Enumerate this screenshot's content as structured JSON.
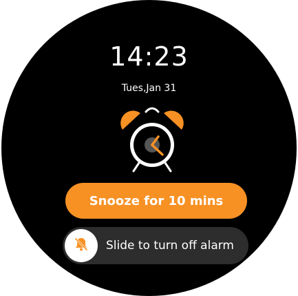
{
  "alarm": {
    "time": "14:23",
    "date": "Tues,Jan 31"
  },
  "actions": {
    "snooze_label": "Snooze for 10 mins",
    "slide_label": "Slide to turn off alarm"
  },
  "icons": {
    "alarm_clock": "alarm-clock-icon",
    "alarm_off": "alarm-off-icon"
  },
  "colors": {
    "accent": "#f79124",
    "background": "#000000",
    "track": "#2d2d2d",
    "text": "#ffffff"
  }
}
